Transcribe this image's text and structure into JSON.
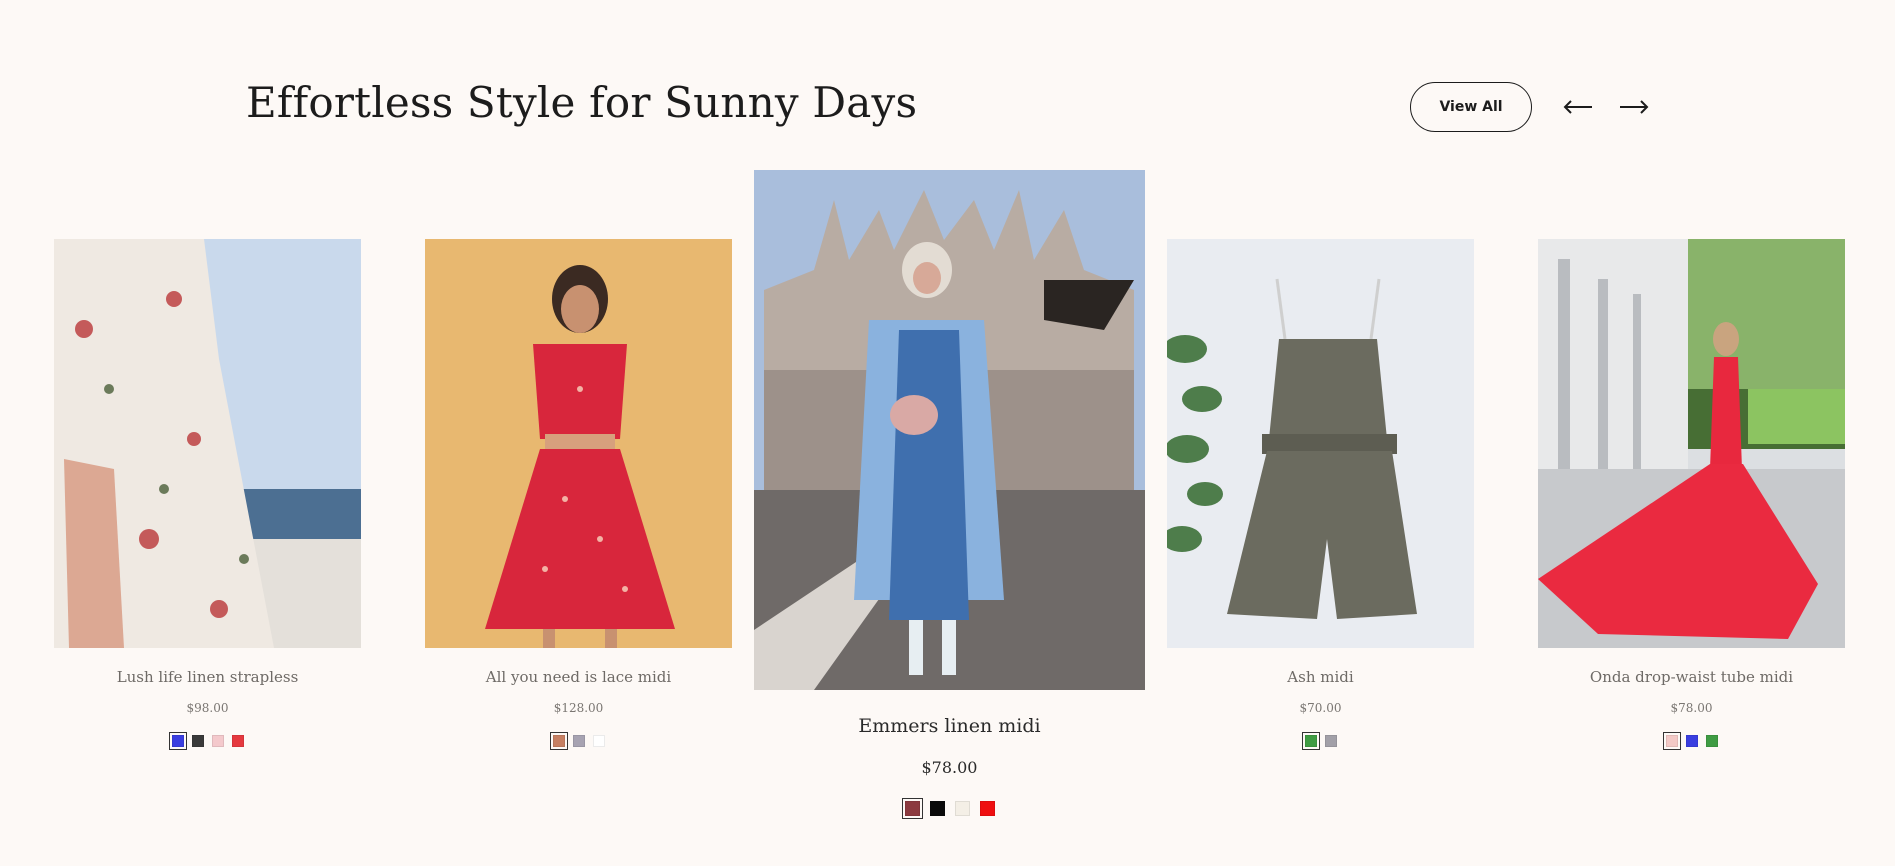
{
  "section": {
    "title": "Effortless Style for Sunny Days",
    "view_all_label": "View All",
    "prev_icon": "arrow-left-icon",
    "next_icon": "arrow-right-icon"
  },
  "products": [
    {
      "name": "Lush life linen strapless",
      "price": "$98.00",
      "image": "floral-dress-photo",
      "swatches": [
        "#3a3ee0",
        "#3a3a3a",
        "#f4c9cc",
        "#e5393f"
      ],
      "selected_swatch": 0
    },
    {
      "name": "All you need is lace midi",
      "price": "$128.00",
      "image": "red-floral-midi-photo",
      "swatches": [
        "#c67f62",
        "#a7a3b2",
        "#ffffff"
      ],
      "selected_swatch": 0
    },
    {
      "name": "Emmers linen midi",
      "price": "$78.00",
      "image": "blue-coat-cathedral-photo",
      "swatches": [
        "#8c3a3f",
        "#0a0a0a",
        "#f4efe6",
        "#ef0f10"
      ],
      "selected_swatch": 0
    },
    {
      "name": "Ash midi",
      "price": "$70.00",
      "image": "olive-romper-photo",
      "swatches": [
        "#3f9c43",
        "#a2a0a8"
      ],
      "selected_swatch": 0
    },
    {
      "name": "Onda drop-waist tube midi",
      "price": "$78.00",
      "image": "red-gown-photo",
      "swatches": [
        "#f3c9c6",
        "#3a3ee0",
        "#3f9c43"
      ],
      "selected_swatch": 0
    }
  ]
}
